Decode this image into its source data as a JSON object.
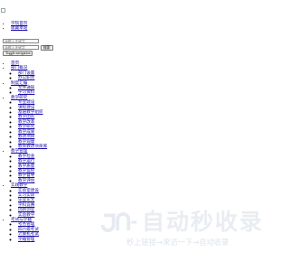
{
  "header": {
    "logo_icon": "broken-image-icon"
  },
  "top_links": [
    "学院首页",
    "收藏本站"
  ],
  "search": {
    "placeholder": "请输入关键字",
    "button": "搜索"
  },
  "toggle_label": "Toggle navigation",
  "nav": [
    {
      "label": "首页",
      "children": []
    },
    {
      "label": "部门概况",
      "children": [
        "部门设置",
        "办公职责"
      ]
    },
    {
      "label": "制度汇编",
      "children": [
        "文件通知",
        "学习资料"
      ]
    },
    {
      "label": "教学研究",
      "children": [
        "专业建设",
        "课程建设",
        "基层教学组织",
        "教学团队",
        "教学改革",
        "教学研究",
        "教学成果",
        "教改项目",
        "教学观摩",
        "教育教改项目库"
      ]
    },
    {
      "label": "教学管理",
      "children": [
        "教学检查",
        "教学运行",
        "教学质量",
        "教学监控",
        "教学督导",
        "教学评估"
      ]
    },
    {
      "label": "实践教学",
      "children": [
        "实验室建设",
        "实习实训",
        "毕业论文",
        "学科竞赛",
        "创新创业",
        "实验教学"
      ]
    },
    {
      "label": "考试与学籍",
      "children": [
        "考务管理",
        "四六级考试",
        "计算机考试",
        "学籍管理"
      ]
    }
  ],
  "watermark": {
    "text": "自动秒收录",
    "subtext": "秒上链接→来访一下→自动收录",
    "color": "#e9edf2"
  }
}
